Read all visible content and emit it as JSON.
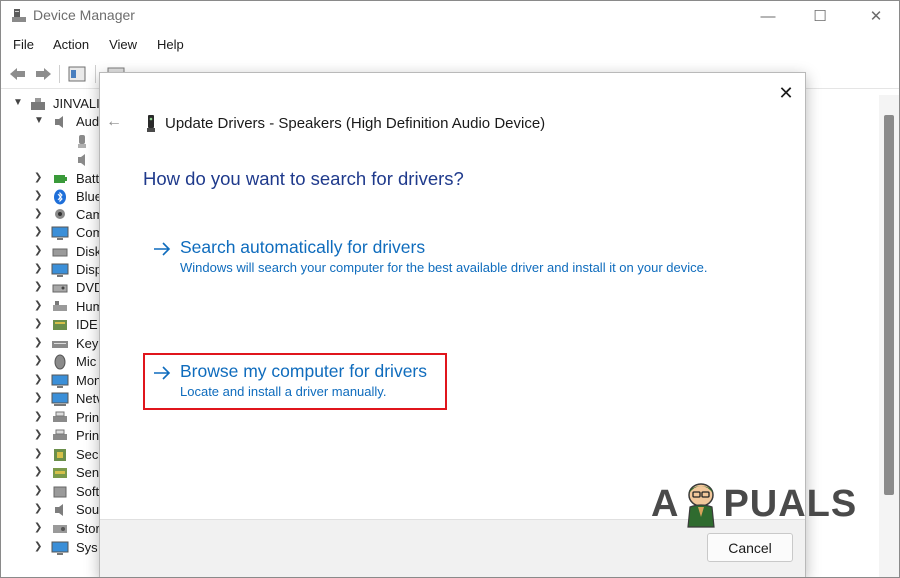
{
  "window": {
    "title": "Device Manager",
    "controls": {
      "minimize": "—",
      "maximize": "☐",
      "close": "✕"
    }
  },
  "menu": [
    "File",
    "Action",
    "View",
    "Help"
  ],
  "tree": {
    "root": "JINVALI",
    "audio_label": "Aud",
    "categories": [
      "Batt",
      "Blue",
      "Cam",
      "Com",
      "Disk",
      "Disp",
      "DVD",
      "Hum",
      "IDE",
      "Key",
      "Mic",
      "Mon",
      "Netv",
      "Prin",
      "Prin",
      "Sec",
      "Sen",
      "Soft",
      "Sou",
      "Stor",
      "Sys"
    ]
  },
  "dialog": {
    "title": "Update Drivers - Speakers (High Definition Audio Device)",
    "question": "How do you want to search for drivers?",
    "option_auto": {
      "title": "Search automatically for drivers",
      "description": "Windows will search your computer for the best available driver and install it on your device."
    },
    "option_browse": {
      "title": "Browse my computer for drivers",
      "description": "Locate and install a driver manually."
    },
    "cancel_label": "Cancel",
    "close_glyph": "✕",
    "back_glyph": "←"
  },
  "watermark": {
    "left": "A",
    "right": "PUALS"
  },
  "colors": {
    "link_blue": "#0f6cbd",
    "heading_blue": "#1f3a8c",
    "highlight_red": "#e0151c",
    "footer_gray": "#f1f1f1"
  },
  "icons": {
    "app": "device-manager-icon",
    "back": "back-arrow-icon",
    "option": "right-arrow-icon",
    "dialog_device": "speaker-device-icon"
  }
}
